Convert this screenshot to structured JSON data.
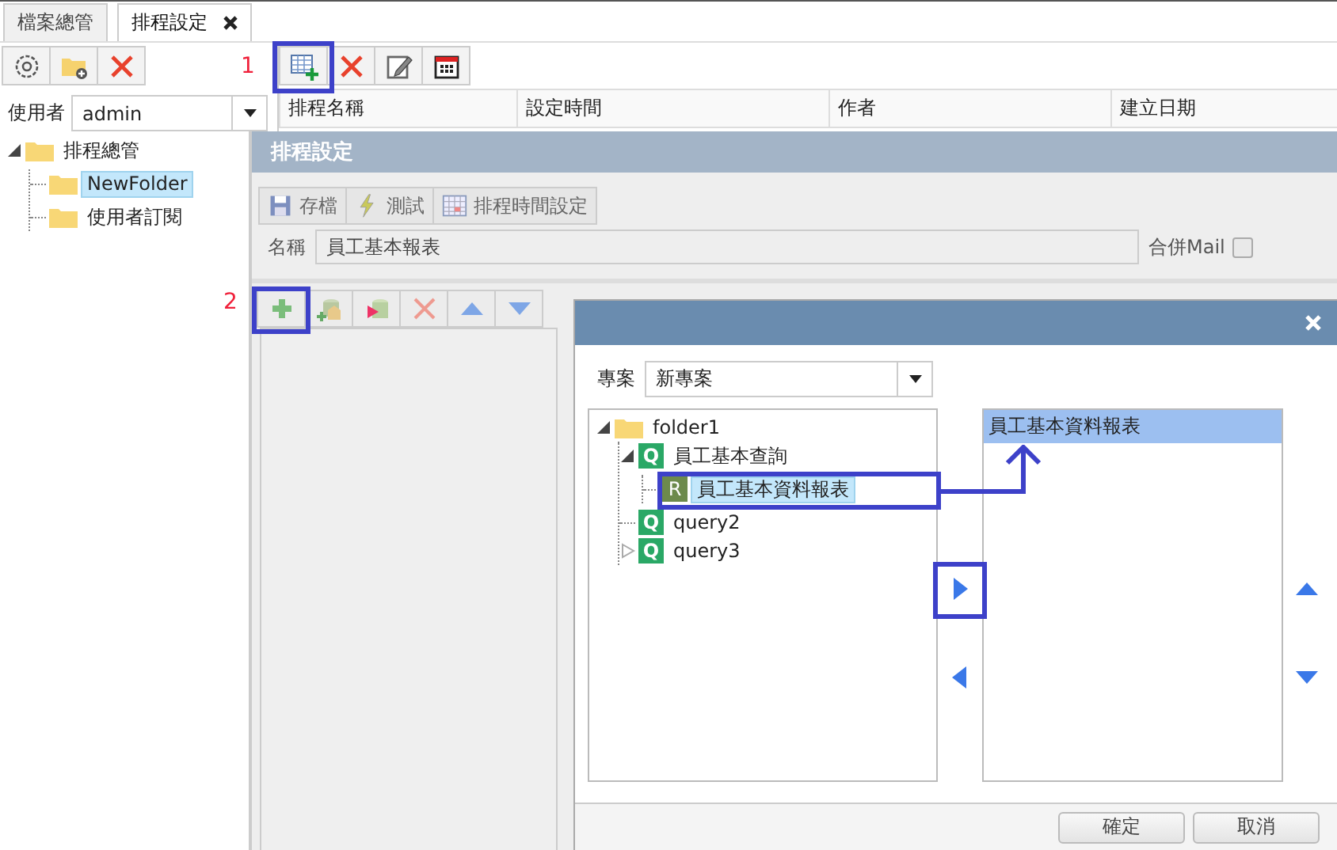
{
  "tabs": [
    {
      "label": "檔案總管",
      "selected": false,
      "closable": false
    },
    {
      "label": "排程設定",
      "selected": true,
      "closable": true
    }
  ],
  "user_filter": {
    "label": "使用者",
    "value": "admin"
  },
  "folder_tree": [
    {
      "label": "排程總管",
      "kind": "folder",
      "expanded": true,
      "selected": false,
      "children": [
        {
          "label": "NewFolder",
          "kind": "folder",
          "selected": true
        },
        {
          "label": "使用者訂閱",
          "kind": "folder",
          "selected": false
        }
      ]
    }
  ],
  "schedule_toolbar": {
    "annotation": "1"
  },
  "schedule_grid": {
    "columns": [
      "排程名稱",
      "設定時間",
      "作者",
      "建立日期"
    ]
  },
  "schedule_panel": {
    "title": "排程設定",
    "buttons": [
      "存檔",
      "測試",
      "排程時間設定"
    ],
    "name_label": "名稱",
    "name_value": "員工基本報表",
    "merge_mail": {
      "label": "合併Mail",
      "checked": false
    },
    "annotation": "2"
  },
  "dialog": {
    "project_label": "專案",
    "project_value": "新專案",
    "tree": [
      {
        "label": "folder1",
        "kind": "folder",
        "expanded": true,
        "selected": false,
        "children": [
          {
            "label": "員工基本查詢",
            "kind": "query",
            "badge": "Q",
            "expanded": true,
            "selected": false,
            "children": [
              {
                "label": "員工基本資料報表",
                "kind": "report",
                "badge": "R",
                "selected": true
              }
            ]
          },
          {
            "label": "query2",
            "kind": "query",
            "badge": "Q",
            "selected": false
          },
          {
            "label": "query3",
            "kind": "query",
            "badge": "Q",
            "expanded": false,
            "selected": false
          }
        ]
      }
    ],
    "selected_items": [
      {
        "label": "員工基本資料報表",
        "selected": true
      }
    ],
    "buttons": [
      "確定",
      "取消"
    ]
  }
}
